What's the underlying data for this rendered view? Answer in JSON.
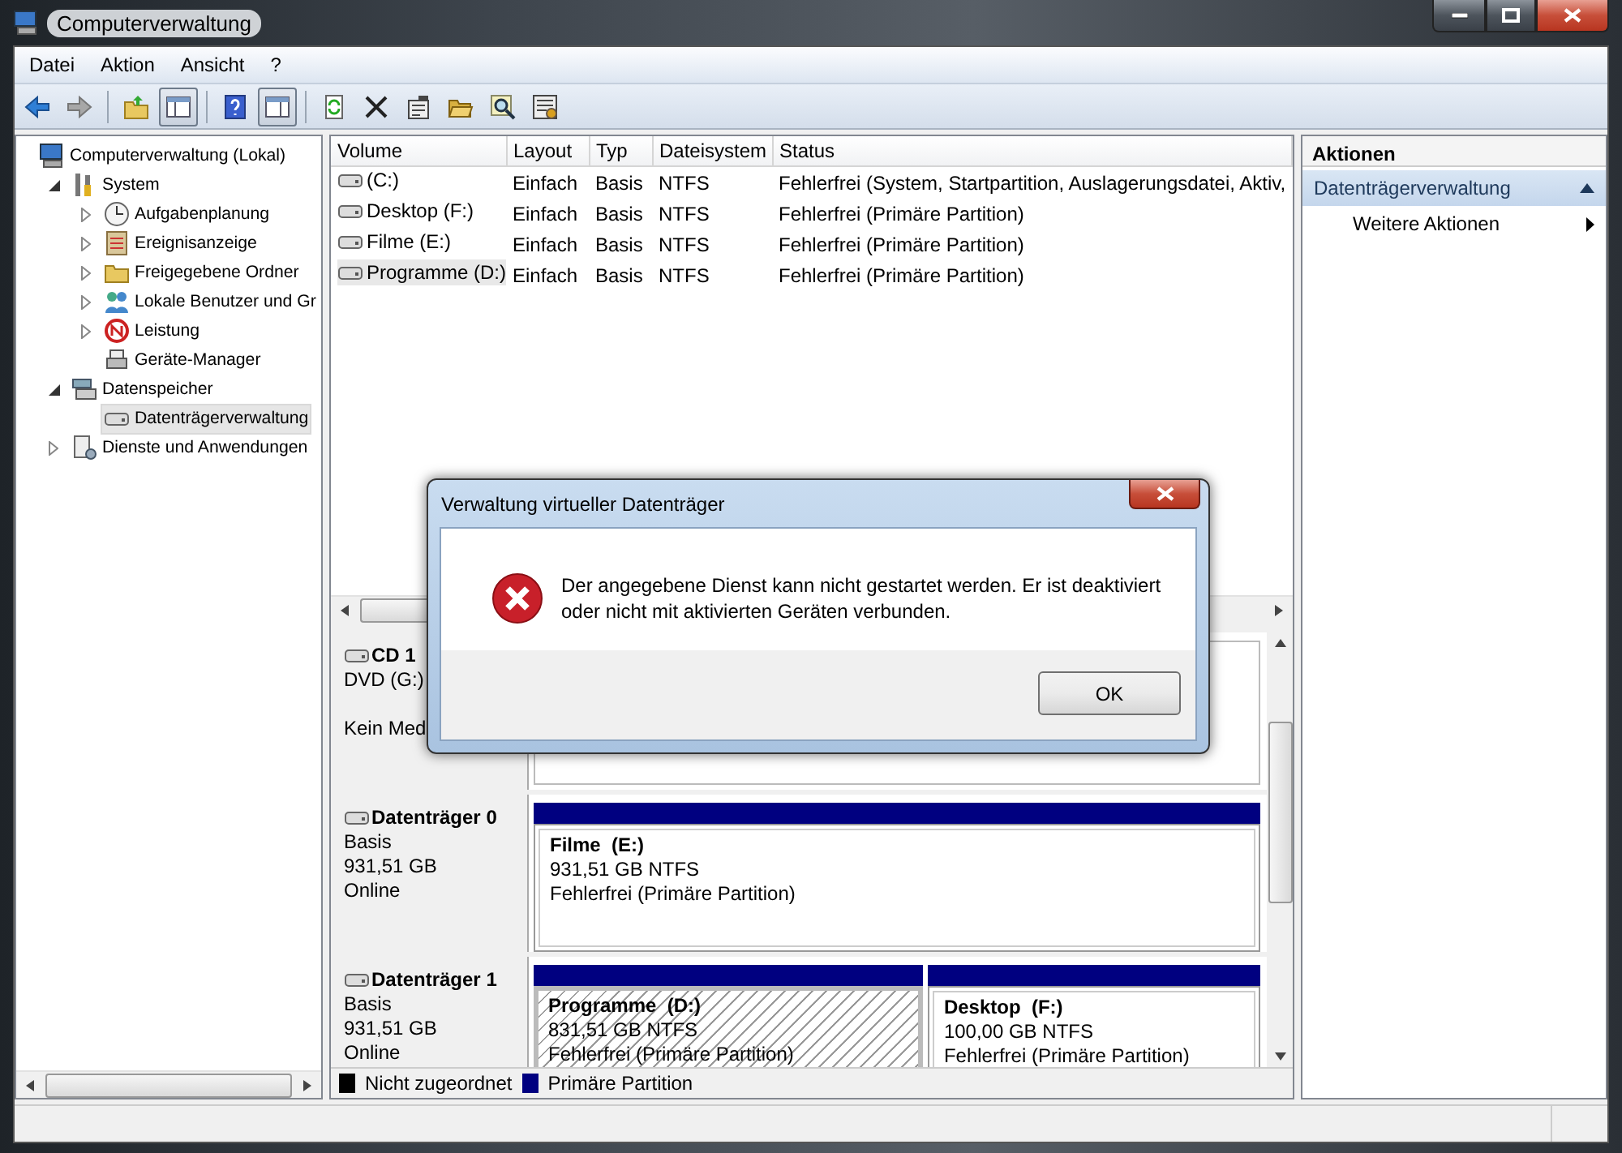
{
  "window": {
    "title": "Computerverwaltung"
  },
  "menu": [
    "Datei",
    "Aktion",
    "Ansicht",
    "?"
  ],
  "toolbar": [
    [
      {
        "on": false
      },
      {
        "on": false
      }
    ],
    [
      {
        "on": false
      },
      {
        "on": true
      }
    ],
    [
      {
        "on": false
      },
      {
        "on": true
      }
    ],
    [
      {
        "on": false
      },
      {
        "on": false
      },
      {
        "on": false
      },
      {
        "on": false
      },
      {
        "on": false
      },
      {
        "on": false
      }
    ]
  ],
  "tree": [
    {
      "label": "Computerverwaltung (Lokal)",
      "selected": false,
      "children": [
        {
          "label": "System",
          "expanded": true,
          "selected": false,
          "children": [
            {
              "label": "Aufgabenplanung",
              "expanded": false,
              "selected": false
            },
            {
              "label": "Ereignisanzeige",
              "expanded": false,
              "selected": false
            },
            {
              "label": "Freigegebene Ordner",
              "expanded": false,
              "selected": false
            },
            {
              "label": "Lokale Benutzer und Gr",
              "expanded": false,
              "selected": false
            },
            {
              "label": "Leistung",
              "expanded": false,
              "selected": false
            },
            {
              "label": "Geräte-Manager",
              "selected": false
            }
          ]
        },
        {
          "label": "Datenspeicher",
          "expanded": true,
          "selected": false,
          "children": [
            {
              "label": "Datenträgerverwaltung",
              "selected": true
            }
          ]
        },
        {
          "label": "Dienste und Anwendungen",
          "expanded": false,
          "selected": false
        }
      ]
    }
  ],
  "volumes": {
    "columns": [
      "Volume",
      "Layout",
      "Typ",
      "Dateisystem",
      "Status"
    ],
    "rows": [
      {
        "cells": [
          "(C:)",
          "Einfach",
          "Basis",
          "NTFS",
          "Fehlerfrei (System, Startpartition, Auslagerungsdatei, Aktiv,"
        ],
        "selected": false
      },
      {
        "cells": [
          "Desktop (F:)",
          "Einfach",
          "Basis",
          "NTFS",
          "Fehlerfrei (Primäre Partition)"
        ],
        "selected": false
      },
      {
        "cells": [
          "Filme (E:)",
          "Einfach",
          "Basis",
          "NTFS",
          "Fehlerfrei (Primäre Partition)"
        ],
        "selected": false
      },
      {
        "cells": [
          "Programme (D:)",
          "Einfach",
          "Basis",
          "NTFS",
          "Fehlerfrei (Primäre Partition)"
        ],
        "selected": true
      }
    ]
  },
  "disks": [
    {
      "kind": "cd",
      "name": "CD 1",
      "lines": [
        "DVD (G:)",
        "Kein Med"
      ]
    },
    {
      "kind": "disk",
      "name": "Datenträger 0",
      "lines": [
        "Basis",
        "931,51 GB",
        "Online"
      ],
      "partitions": [
        {
          "name": "Filme  (E:)",
          "size": "931,51 GB NTFS",
          "status": "Fehlerfrei (Primäre Partition)",
          "color": "#000080",
          "selected": false
        }
      ]
    },
    {
      "kind": "disk",
      "name": "Datenträger 1",
      "lines": [
        "Basis",
        "931,51 GB",
        "Online"
      ],
      "partitions": [
        {
          "name": "Programme  (D:)",
          "size": "831,51 GB NTFS",
          "status": "Fehlerfrei (Primäre Partition)",
          "color": "#000080",
          "selected": true
        },
        {
          "name": "Desktop  (F:)",
          "size": "100,00 GB NTFS",
          "status": "Fehlerfrei (Primäre Partition)",
          "color": "#000080",
          "selected": false
        }
      ]
    }
  ],
  "legend": [
    {
      "label": "Nicht zugeordnet",
      "color": "#000000"
    },
    {
      "label": "Primäre Partition",
      "color": "#000080"
    }
  ],
  "actions": {
    "title": "Aktionen",
    "sections": [
      {
        "label": "Datenträgerverwaltung",
        "expanded": true,
        "items": [
          "Weitere Aktionen"
        ]
      }
    ]
  },
  "dialog": {
    "title": "Verwaltung virtueller Datenträger",
    "message": "Der angegebene Dienst kann nicht gestartet werden. Er ist deaktiviert oder nicht mit aktivierten Geräten verbunden.",
    "button": "OK"
  }
}
